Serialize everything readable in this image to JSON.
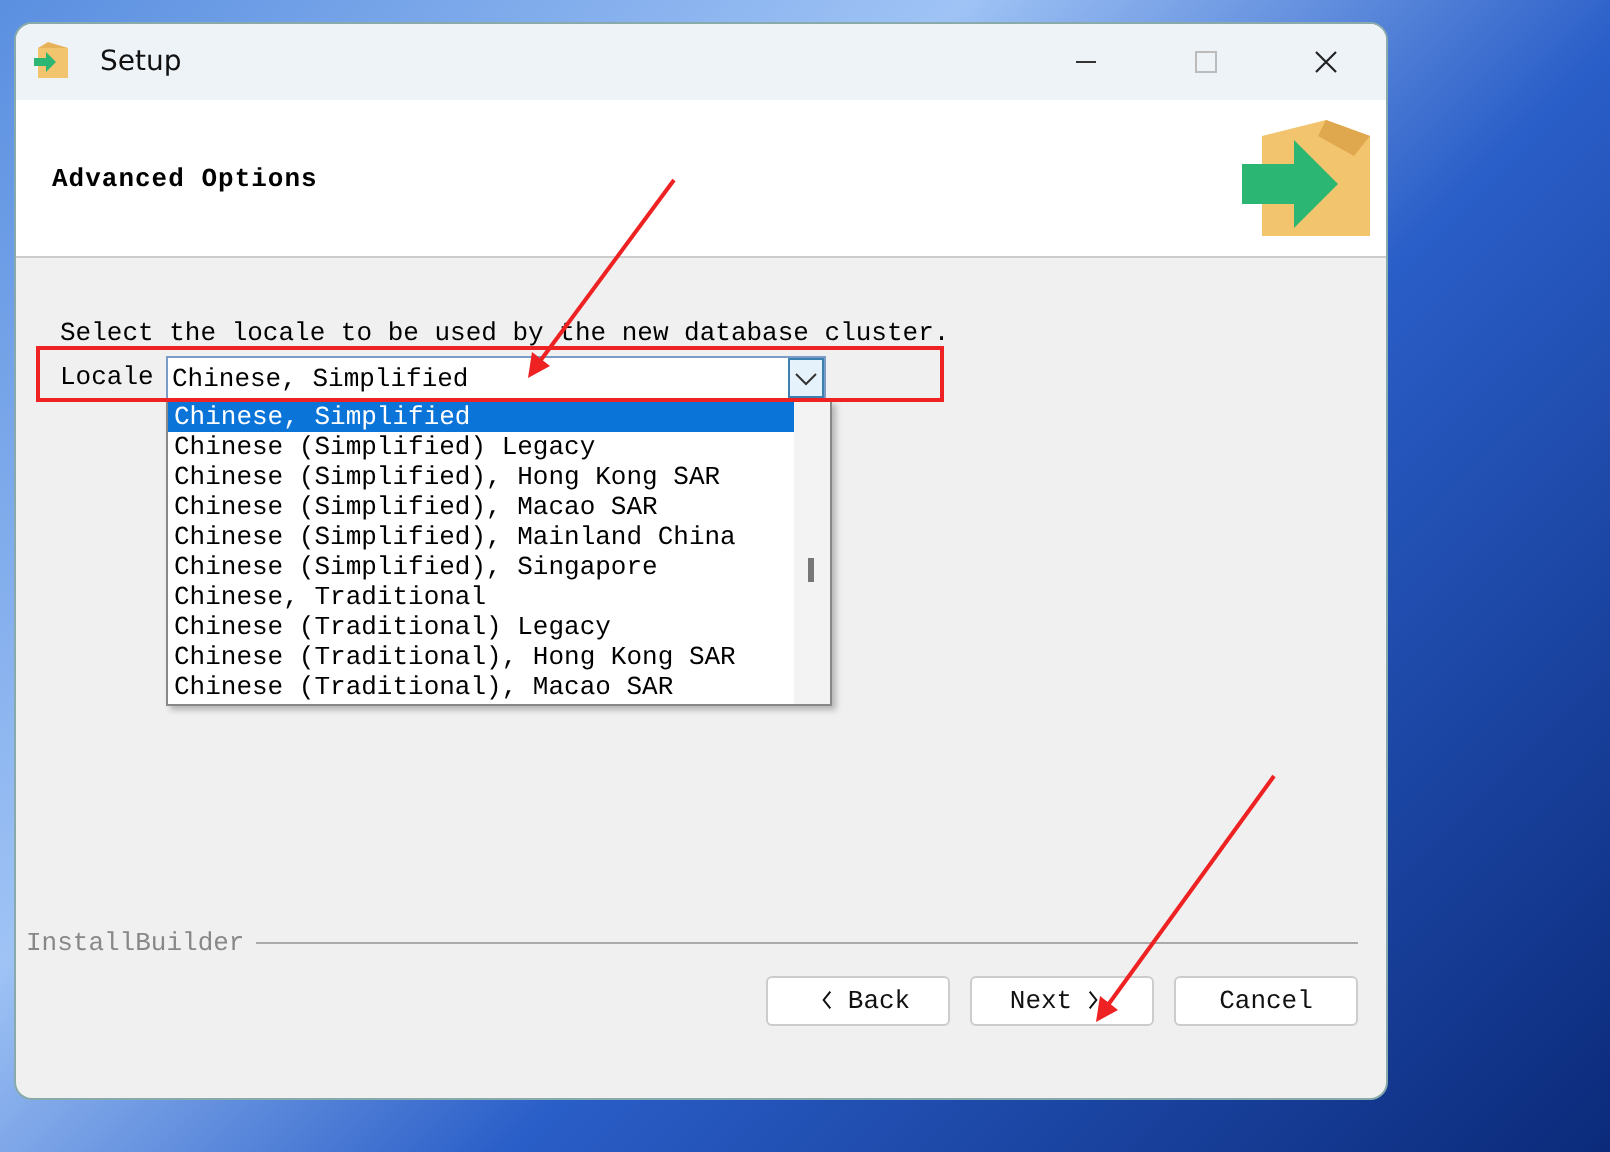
{
  "window": {
    "title": "Setup"
  },
  "header": {
    "title": "Advanced Options"
  },
  "description": "Select the locale to be used by the new database cluster.",
  "locale": {
    "label": "Locale",
    "value": "Chinese, Simplified",
    "expanded": true,
    "options": [
      {
        "label": "Chinese, Simplified",
        "selected": true
      },
      {
        "label": "Chinese (Simplified) Legacy",
        "selected": false
      },
      {
        "label": "Chinese (Simplified), Hong Kong SAR",
        "selected": false
      },
      {
        "label": "Chinese (Simplified), Macao SAR",
        "selected": false
      },
      {
        "label": "Chinese (Simplified), Mainland China",
        "selected": false
      },
      {
        "label": "Chinese (Simplified), Singapore",
        "selected": false
      },
      {
        "label": "Chinese, Traditional",
        "selected": false
      },
      {
        "label": "Chinese (Traditional) Legacy",
        "selected": false
      },
      {
        "label": "Chinese (Traditional), Hong Kong SAR",
        "selected": false
      },
      {
        "label": "Chinese (Traditional), Macao SAR",
        "selected": false
      }
    ]
  },
  "footer": {
    "brand": "InstallBuilder"
  },
  "buttons": [
    {
      "label": "Back",
      "kind": "back"
    },
    {
      "label": "Next",
      "kind": "next"
    },
    {
      "label": "Cancel",
      "kind": "plain"
    }
  ]
}
